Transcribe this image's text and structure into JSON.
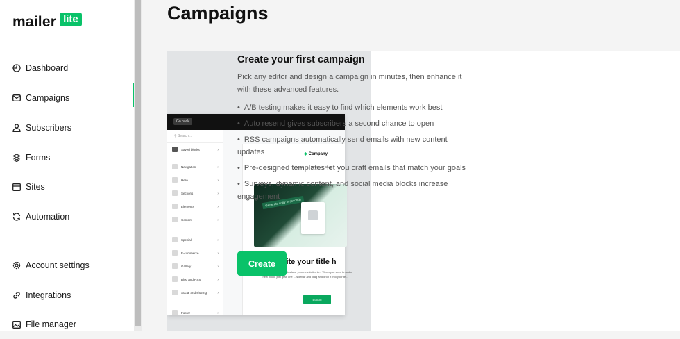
{
  "app": {
    "logo_text": "mailer",
    "logo_badge": "lite",
    "accent": "#09c269"
  },
  "sidebar": {
    "items": [
      {
        "label": "Dashboard",
        "icon": "dashboard-gauge-icon"
      },
      {
        "label": "Campaigns",
        "icon": "mail-icon",
        "active": true
      },
      {
        "label": "Subscribers",
        "icon": "user-icon"
      },
      {
        "label": "Forms",
        "icon": "layers-icon"
      },
      {
        "label": "Sites",
        "icon": "browser-window-icon"
      },
      {
        "label": "Automation",
        "icon": "refresh-icon"
      },
      {
        "label": "Account settings",
        "icon": "gear-icon"
      },
      {
        "label": "Integrations",
        "icon": "link-icon"
      },
      {
        "label": "File manager",
        "icon": "image-icon"
      }
    ]
  },
  "main": {
    "title": "Campaigns",
    "card": {
      "heading": "Create your first campaign",
      "intro": "Pick any editor and design a campaign in minutes, then enhance it with these advanced features.",
      "features": [
        "A/B testing makes it easy to find which elements work best",
        "Auto resend gives subscribers a second chance to open",
        "RSS campaigns automatically send emails with new content updates",
        "Pre-designed templates let you craft emails that match your goals",
        "Surveys, dynamic content, and social media blocks increase engagement"
      ],
      "create_label": "Create"
    },
    "preview": {
      "go_back": "Go back",
      "search_placeholder": "Search...",
      "blocks": [
        "Saved blocks",
        "Navigation",
        "Hero",
        "Sections",
        "Elements",
        "Content",
        "Special",
        "E-commerce",
        "Gallery",
        "Blog and RSS",
        "Social and sharing",
        "Footer"
      ],
      "company": "Company",
      "nav": [
        "About",
        "New!",
        "Shop"
      ],
      "hero_tag": "Generate copy in seconds",
      "write_title": "Write your title h",
      "write_sub": "Start typing here and introduce your newsletter to... When you want to add a new block, just grab one ... sidebar and drag and drop it into your te...",
      "button": "Button"
    }
  }
}
